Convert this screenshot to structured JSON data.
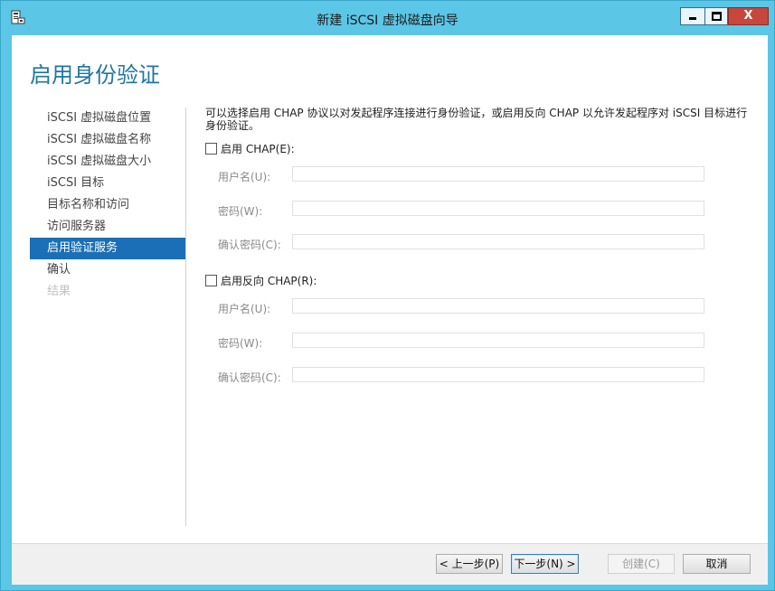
{
  "window": {
    "title": "新建 iSCSI 虚拟磁盘向导",
    "close_glyph": "X"
  },
  "page": {
    "title": "启用身份验证"
  },
  "nav": {
    "items": [
      {
        "label": "iSCSI 虚拟磁盘位置",
        "state": "normal"
      },
      {
        "label": "iSCSI 虚拟磁盘名称",
        "state": "normal"
      },
      {
        "label": "iSCSI 虚拟磁盘大小",
        "state": "normal"
      },
      {
        "label": "iSCSI 目标",
        "state": "normal"
      },
      {
        "label": "目标名称和访问",
        "state": "normal"
      },
      {
        "label": "访问服务器",
        "state": "normal"
      },
      {
        "label": "启用验证服务",
        "state": "active"
      },
      {
        "label": "确认",
        "state": "normal"
      },
      {
        "label": "结果",
        "state": "disabled"
      }
    ]
  },
  "content": {
    "description": "可以选择启用 CHAP 协议以对发起程序连接进行身份验证，或启用反向 CHAP 以允许发起程序对 iSCSI 目标进行身份验证。",
    "chap": {
      "checkbox_label": "启用 CHAP(E):",
      "checked": false,
      "username_label": "用户名(U):",
      "username_value": "",
      "password_label": "密码(W):",
      "password_value": "",
      "confirm_label": "确认密码(C):",
      "confirm_value": ""
    },
    "reverse_chap": {
      "checkbox_label": "启用反向 CHAP(R):",
      "checked": false,
      "username_label": "用户名(U):",
      "username_value": "",
      "password_label": "密码(W):",
      "password_value": "",
      "confirm_label": "确认密码(C):",
      "confirm_value": ""
    }
  },
  "footer": {
    "prev_label": "< 上一步(P)",
    "next_label": "下一步(N) >",
    "create_label": "创建(C)",
    "cancel_label": "取消"
  },
  "colors": {
    "window_frame": "#5bc6e6",
    "title_accent": "#1f76a1",
    "nav_active": "#1b6fb6",
    "close_button": "#c7463e"
  }
}
